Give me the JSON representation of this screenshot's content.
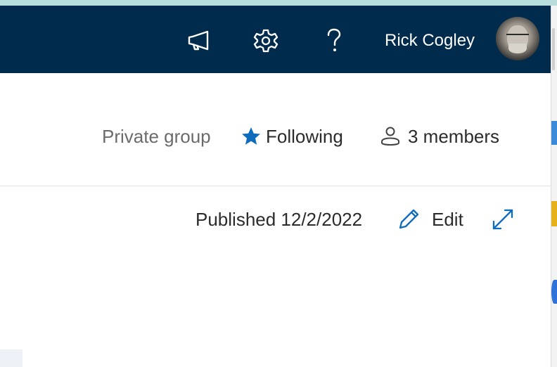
{
  "header": {
    "user_name": "Rick Cogley",
    "icons": [
      "megaphone-icon",
      "gear-icon",
      "help-icon",
      "avatar"
    ]
  },
  "group_meta": {
    "privacy": "Private group",
    "following_label": "Following",
    "members_label": "3 members"
  },
  "page_meta": {
    "published": "Published 12/2/2022",
    "edit_label": "Edit"
  },
  "colors": {
    "header_bg": "#002b4d",
    "accent": "#0f6cbd",
    "text": "#2b2b2b",
    "muted": "#6b6b6b"
  }
}
